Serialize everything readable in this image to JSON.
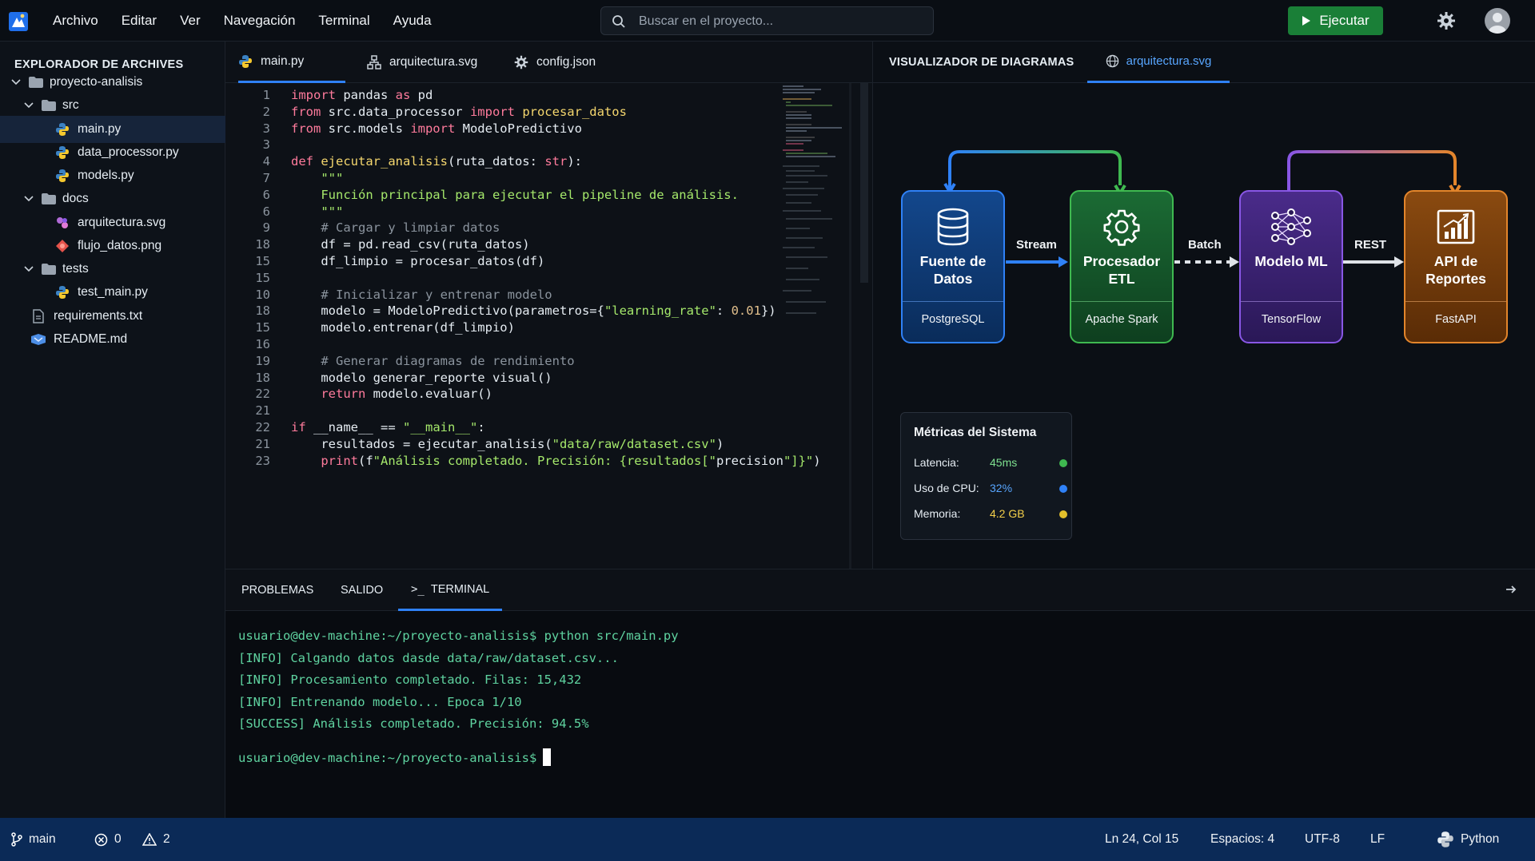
{
  "menu": {
    "items": [
      "Archivo",
      "Editar",
      "Ver",
      "Navegación",
      "Terminal",
      "Ayuda"
    ],
    "search_placeholder": "Buscar en el proyecto...",
    "run_label": "Ejecutar"
  },
  "sidebar": {
    "title": "EXPLORADOR DE ARCHIVES",
    "tree": [
      {
        "label": "proyecto-analisis",
        "icon": "folder-icon",
        "expanded": true
      },
      {
        "label": "src",
        "icon": "folder-icon",
        "expanded": true
      },
      {
        "label": "main.py",
        "icon": "python-icon",
        "selected": true
      },
      {
        "label": "data_processor.py",
        "icon": "python-icon"
      },
      {
        "label": "models.py",
        "icon": "python-icon"
      },
      {
        "label": "docs",
        "icon": "folder-icon",
        "expanded": true
      },
      {
        "label": "arquitectura.svg",
        "icon": "svg-file-icon"
      },
      {
        "label": "flujo_datos.png",
        "icon": "image-file-icon"
      },
      {
        "label": "tests",
        "icon": "folder-icon",
        "expanded": true
      },
      {
        "label": "test_main.py",
        "icon": "python-icon"
      },
      {
        "label": "requirements.txt",
        "icon": "text-file-icon"
      },
      {
        "label": "README.md",
        "icon": "markdown-icon"
      }
    ]
  },
  "editor": {
    "tabs": [
      {
        "label": "main.py",
        "icon": "python-icon",
        "active": true
      },
      {
        "label": "arquitectura.svg",
        "icon": "diagram-icon"
      },
      {
        "label": "config.json",
        "icon": "gear-icon"
      }
    ],
    "line_numbers": [
      "1",
      "2",
      "3",
      "3",
      "4",
      "7",
      "6",
      "6",
      "9",
      "18",
      "15",
      "15",
      "10",
      "18",
      "15",
      "16",
      "19",
      "18",
      "22",
      "21",
      "22",
      "21",
      "23"
    ],
    "code": [
      "import pandas as pd",
      "from src.data_processor import procesar_datos",
      "from src.models import ModeloPredictivo",
      "",
      "def ejecutar_analisis(ruta_datos: str):",
      "    \"\"\"",
      "    Función principal para ejecutar el pipeline de análisis.",
      "    \"\"\"",
      "    # Cargar y limpiar datos",
      "    df = pd.read_csv(ruta_datos)",
      "    df_limpio = procesar_datos(df)",
      "",
      "    # Inicializar y entrenar modelo",
      "    modelo = ModeloPredictivo(parametros={\"learning_rate\": 0.01})",
      "    modelo.entrenar(df_limpio)",
      "",
      "    # Generar diagramas de rendimiento",
      "    modelo generar_reporte visual()",
      "    return modelo.evaluar()",
      "",
      "if __name__ == \"__main__\":",
      "    resultados = ejecutar_analisis(\"data/raw/dataset.csv\")",
      "    print(f\"Análisis completado. Precisión: {resultados[\"precision\"]}\")"
    ]
  },
  "diagram": {
    "title": "VISUALIZADOR DE DIAGRAMAS",
    "tab_label": "arquitectura.svg",
    "nodes": [
      {
        "title": "Fuente de Datos",
        "subtitle": "PostgreSQL",
        "color": "#2f81f7",
        "bg": "#0f3d7a",
        "icon": "database-icon"
      },
      {
        "title": "Procesador ETL",
        "subtitle": "Apache Spark",
        "color": "#3fb950",
        "bg": "#155c2c",
        "icon": "gear-icon"
      },
      {
        "title": "Modelo ML",
        "subtitle": "TensorFlow",
        "color": "#8957e5",
        "bg": "#3d2470",
        "icon": "neural-network-icon"
      },
      {
        "title": "API de Reportes",
        "subtitle": "FastAPI",
        "color": "#e3852b",
        "bg": "#7a3f0c",
        "icon": "bar-chart-icon"
      }
    ],
    "connectors": [
      "Stream",
      "Batch",
      "REST"
    ],
    "metrics": {
      "title": "Métricas del Sistema",
      "rows": [
        {
          "label": "Latencia:",
          "value": "45ms",
          "color": "#3fb950"
        },
        {
          "label": "Uso de CPU:",
          "value": "32%",
          "color": "#2f81f7"
        },
        {
          "label": "Memoria:",
          "value": "4.2 GB",
          "color": "#e3c02b"
        }
      ]
    }
  },
  "panel": {
    "tabs": [
      "PROBLEMAS",
      "SALIDO",
      "TERMINAL"
    ],
    "terminal": [
      "usuario@dev-machine:~/proyecto-analisis$ python src/main.py",
      "[INFO] Calgando datos dasde data/raw/dataset.csv...",
      "[INFO] Procesamiento completado. Filas: 15,432",
      "[INFO] Entrenando modelo... Epoca 1/10",
      "[SUCCESS] Análisis completado. Precisión: 94.5%"
    ],
    "prompt": "usuario@dev-machine:~/proyecto-analisis$"
  },
  "status": {
    "branch": "main",
    "errors": "0",
    "warnings": "2",
    "position": "Ln 24, Col 15",
    "spaces": "Espacios: 4",
    "encoding": "UTF-8",
    "eol": "LF",
    "language": "Python"
  }
}
